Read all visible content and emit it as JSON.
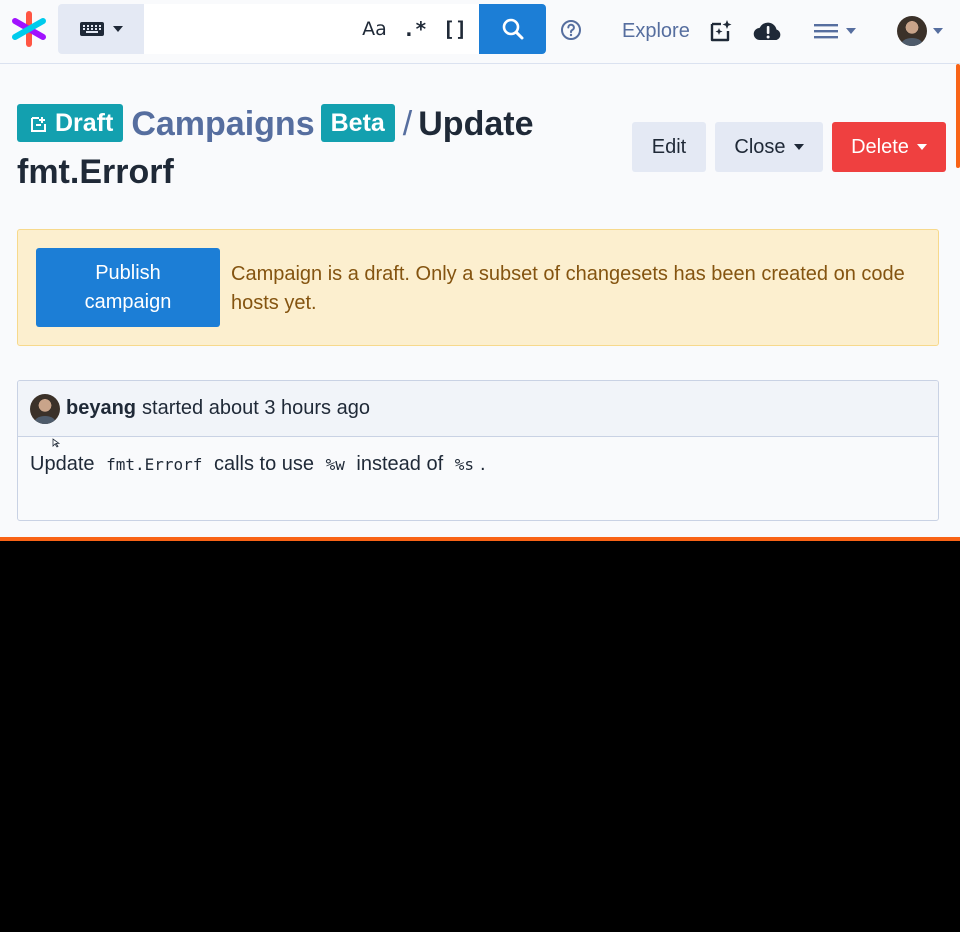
{
  "navbar": {
    "search": {
      "value": "",
      "placeholder": ""
    },
    "options": {
      "case_label": "Aa",
      "regex_label": ".*",
      "structural_label": "[]"
    },
    "explore_label": "Explore",
    "icons": [
      "sourcegraph-logo-icon",
      "keyboard-icon",
      "search-icon",
      "help-icon",
      "insights-icon",
      "cloud-alert-icon",
      "hamburger-menu-icon",
      "user-avatar"
    ]
  },
  "header": {
    "draft_badge": "Draft",
    "campaigns_link": "Campaigns",
    "beta_badge": "Beta",
    "separator": "/",
    "title": "Update fmt.Errorf"
  },
  "actions": {
    "edit_label": "Edit",
    "close_label": "Close",
    "delete_label": "Delete"
  },
  "alert": {
    "publish_label": "Publish campaign",
    "message": "Campaign is a draft. Only a subset of changesets has been created on code hosts yet."
  },
  "description": {
    "author": "beyang",
    "started": "started about 3 hours ago",
    "body": {
      "prefix": "Update",
      "code1": "fmt.Errorf",
      "middle": "calls to use",
      "code2": "%w",
      "middle2": "instead of",
      "code3": "%s",
      "suffix": "."
    }
  },
  "colors": {
    "primary": "#1c7ed6",
    "teal_badge": "#13a0af",
    "danger": "#ef4040",
    "warning_bg": "#fcefcf",
    "warning_text": "#845410",
    "accent_orange": "#f96316"
  }
}
